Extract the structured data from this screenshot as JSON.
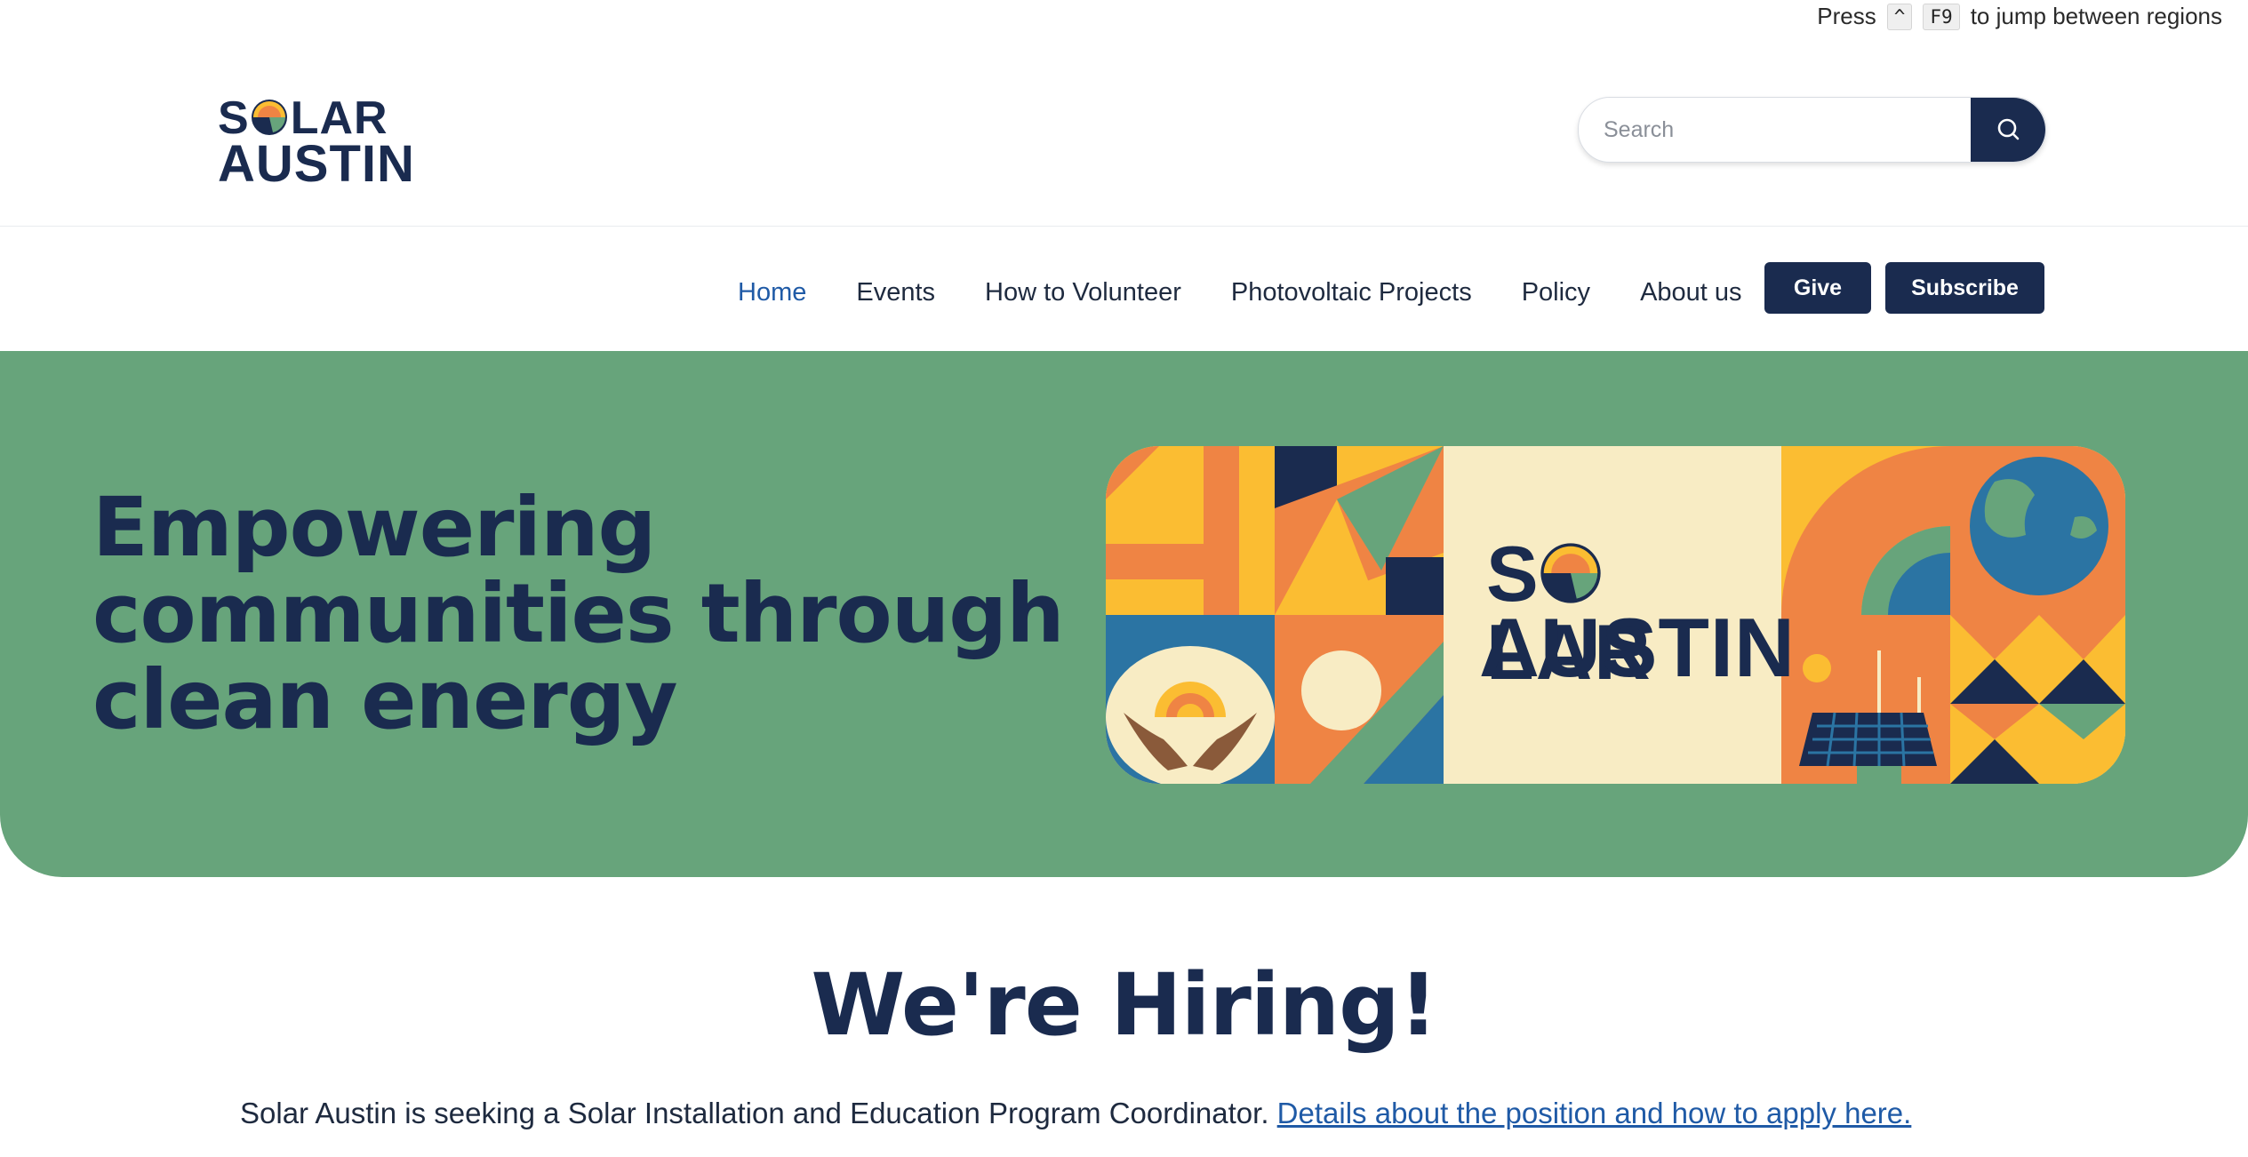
{
  "skip_hint": {
    "prefix": "Press",
    "key1": "^",
    "key2": "F9",
    "suffix": "to jump between regions"
  },
  "logo": {
    "line1_pre": "S",
    "line1_post": "LAR",
    "line2": "AUSTIN"
  },
  "search": {
    "placeholder": "Search",
    "icon": "search-icon"
  },
  "nav": {
    "items": [
      {
        "label": "Home",
        "active": true
      },
      {
        "label": "Events"
      },
      {
        "label": "How to Volunteer"
      },
      {
        "label": "Photovoltaic Projects"
      },
      {
        "label": "Policy"
      },
      {
        "label": "About us"
      }
    ],
    "give_label": "Give",
    "subscribe_label": "Subscribe"
  },
  "hero": {
    "title": "Empowering communities through clean energy",
    "banner": {
      "line1_pre": "S",
      "line1_post": "LAR",
      "line2": "AUSTIN"
    }
  },
  "hiring": {
    "title": "We're Hiring!",
    "text": "Solar Austin is seeking a Solar Installation and Education Program Coordinator.",
    "link": "Details about the position and how to apply here."
  },
  "colors": {
    "navy": "#1a2b4f",
    "green": "#67a47b",
    "orange": "#ef8444",
    "yellow": "#fbbd32",
    "blue": "#2b74a3",
    "cream": "#f8ecc4",
    "link": "#1f5aa6"
  }
}
